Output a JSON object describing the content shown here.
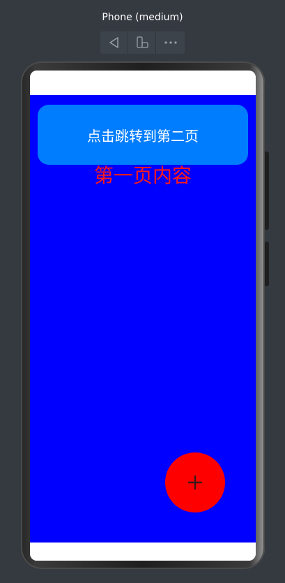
{
  "device": {
    "title": "Phone (medium)"
  },
  "toolbar": {
    "buttons": [
      {
        "icon": "back-triangle-icon"
      },
      {
        "icon": "rotate-device-icon"
      },
      {
        "icon": "more-dots-icon"
      }
    ]
  },
  "app": {
    "jump_button_label": "点击跳转到第二页",
    "page_text": "第一页内容",
    "fab_icon": "plus-icon",
    "colors": {
      "content_background": "#0000ff",
      "button_background": "#007dfe",
      "page_text": "#ff1a1a",
      "fab_background": "#ff0000"
    }
  }
}
